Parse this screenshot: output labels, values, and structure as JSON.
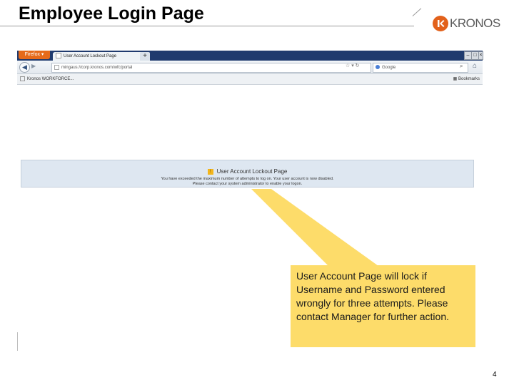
{
  "slide": {
    "title": "Employee Login Page",
    "page_number": "4",
    "logo_text": "KRONOS"
  },
  "browser": {
    "menu_label": "Firefox",
    "tab_title": "User Account Lockout Page",
    "new_tab_label": "+",
    "url": "mingaus://corp.kronos.com/wfc/portal",
    "search_placeholder": "Google",
    "bookmark_item": "Kronos WORKFORCE...",
    "bookmarks_label": "Bookmarks"
  },
  "lockout": {
    "title": "User Account Lockout Page",
    "line1": "You have exceeded the maximum number of attempts to log on. Your user account is now disabled.",
    "line2": "Please contact your system administrator to enable your logon."
  },
  "callout": {
    "text": "User Account  Page will lock if Username and Password entered wrongly for three attempts. Please contact Manager for further action.",
    "color": "#fddc6a"
  },
  "colors": {
    "tabbar": "#1f3a6e",
    "firefox_menu": "#e66a1a",
    "logo_mark": "#e2611b",
    "banner": "#dee7f1"
  }
}
